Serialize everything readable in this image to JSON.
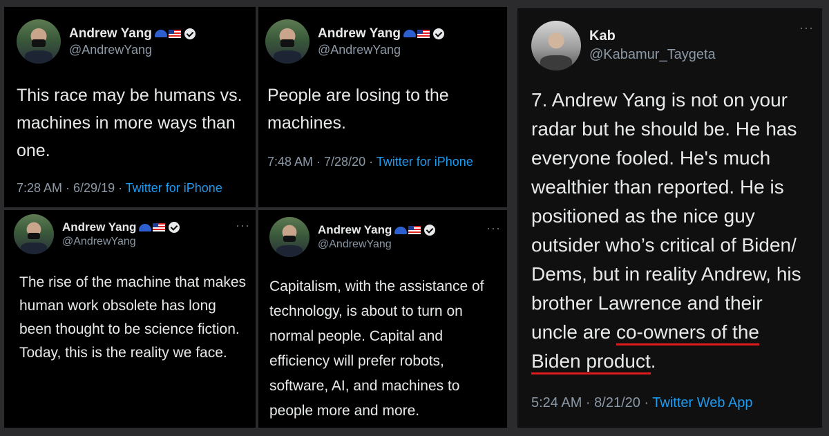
{
  "tweets": [
    {
      "name": "Andrew Yang",
      "handle": "@AndrewYang",
      "text": "This race may be humans vs. machines in more ways than one.",
      "time": "7:28 AM · 6/29/19 · ",
      "source": "Twitter for iPhone"
    },
    {
      "name": "Andrew Yang",
      "handle": "@AndrewYang",
      "text": "People are losing to the machines.",
      "time": "7:48 AM · 7/28/20 · ",
      "source": "Twitter for iPhone"
    },
    {
      "name": "Andrew Yang",
      "handle": "@AndrewYang",
      "text": "The rise of the machine that makes human work obsolete has long been thought to be science fiction. Today, this is the reality we face."
    },
    {
      "name": "Andrew Yang",
      "handle": "@AndrewYang",
      "text": "Capitalism, with the assistance of technology, is about to turn on normal people. Capital and efficiency will prefer robots, software, AI, and machines to people more and more."
    },
    {
      "name": "Kab",
      "handle": "@Kabamur_Taygeta",
      "text_a": "7. Andrew Yang is not on your radar but he should be. He has everyone fooled. He's much wealthier than reported. He is positioned as the nice guy outsider who’s critical of Biden/ Dems, but in reality Andrew, his brother Lawrence and their uncle are ",
      "text_underlined": "co-owners of the Biden product",
      "text_b": ".",
      "time": "5:24 AM · 8/21/20 · ",
      "source": "Twitter Web App"
    }
  ],
  "more_label": "···",
  "icons": [
    "blue-cap-icon",
    "us-flag-icon",
    "verified-badge-icon",
    "more-options-icon"
  ]
}
